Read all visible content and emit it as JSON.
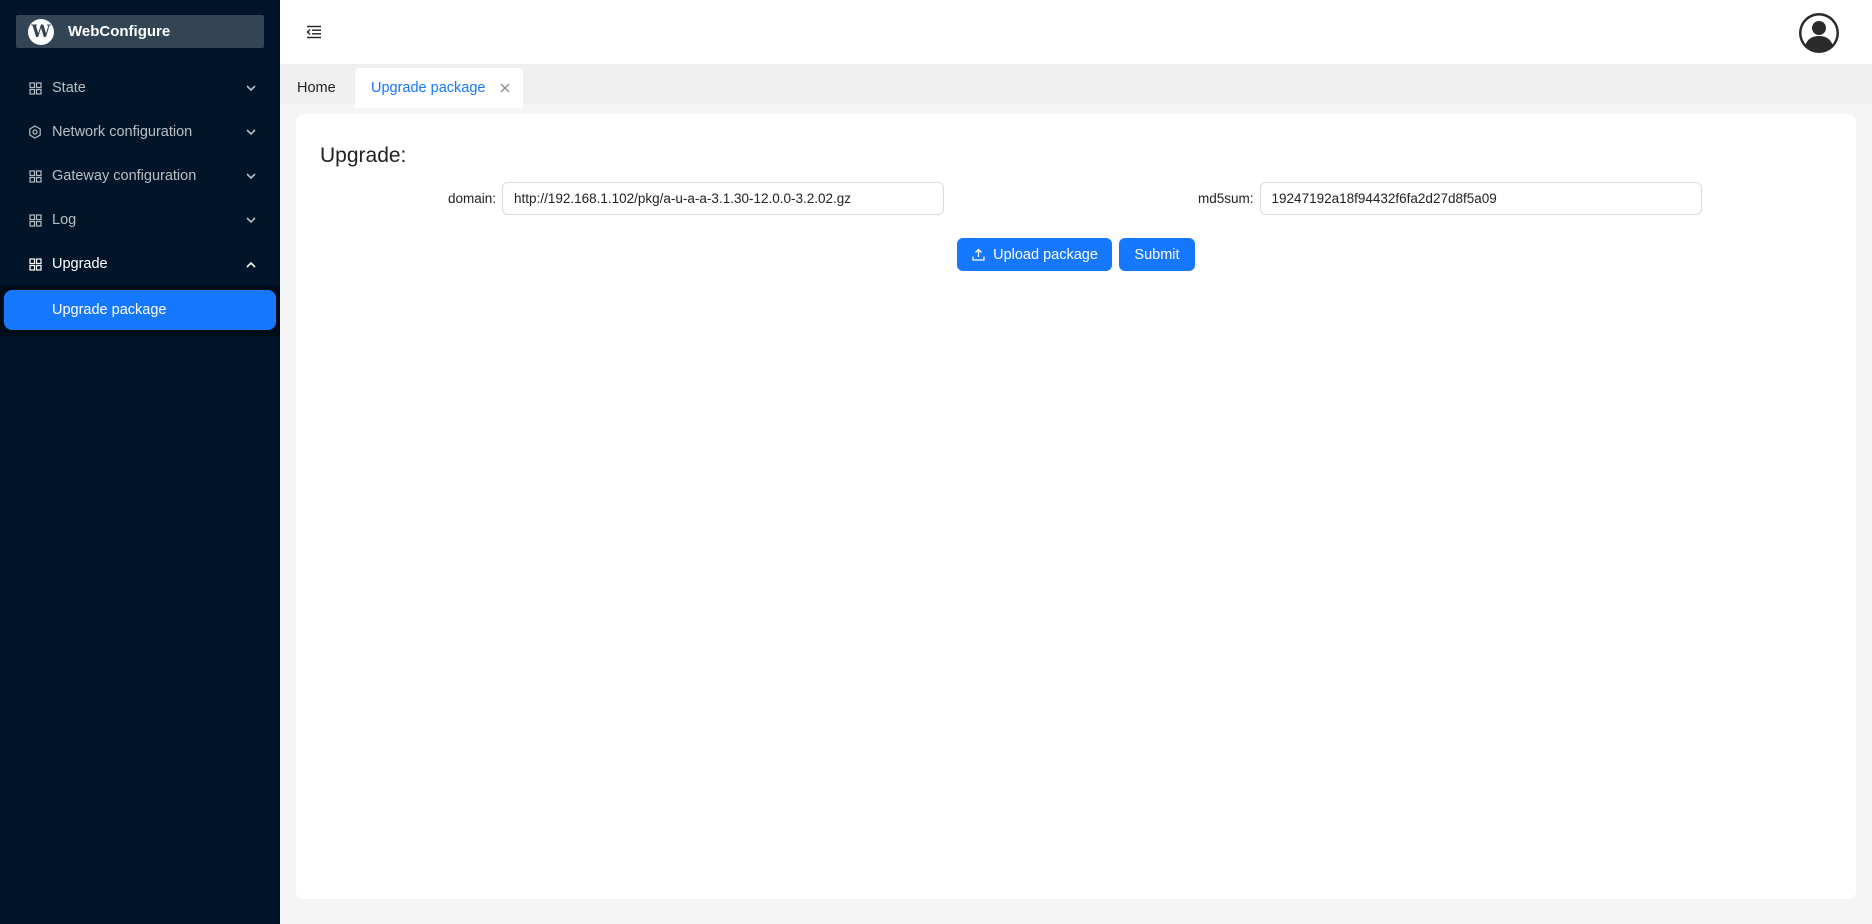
{
  "app": {
    "title": "WebConfigure"
  },
  "sidebar": {
    "items": [
      {
        "label": "State",
        "icon": "grid-icon",
        "expanded": false
      },
      {
        "label": "Network configuration",
        "icon": "gear-icon",
        "expanded": false
      },
      {
        "label": "Gateway configuration",
        "icon": "grid-icon",
        "expanded": false
      },
      {
        "label": "Log",
        "icon": "grid-icon",
        "expanded": false
      },
      {
        "label": "Upgrade",
        "icon": "grid-icon",
        "expanded": true
      }
    ],
    "submenu": {
      "label": "Upgrade package",
      "selected": true
    }
  },
  "tabs": [
    {
      "label": "Home",
      "active": false
    },
    {
      "label": "Upgrade package",
      "active": true,
      "closable": true
    }
  ],
  "page": {
    "title": "Upgrade:",
    "domain_label": "domain",
    "domain_value": "http://192.168.1.102/pkg/a-u-a-a-3.1.30-12.0.0-3.2.02.gz",
    "md5_label": "md5sum",
    "md5_value": "19247192a18f94432f6fa2d27d8f5a09",
    "upload_label": "Upload package",
    "submit_label": "Submit"
  },
  "colors": {
    "sidebar": "#001529",
    "primary": "#1677ff",
    "background": "#f5f5f5"
  }
}
